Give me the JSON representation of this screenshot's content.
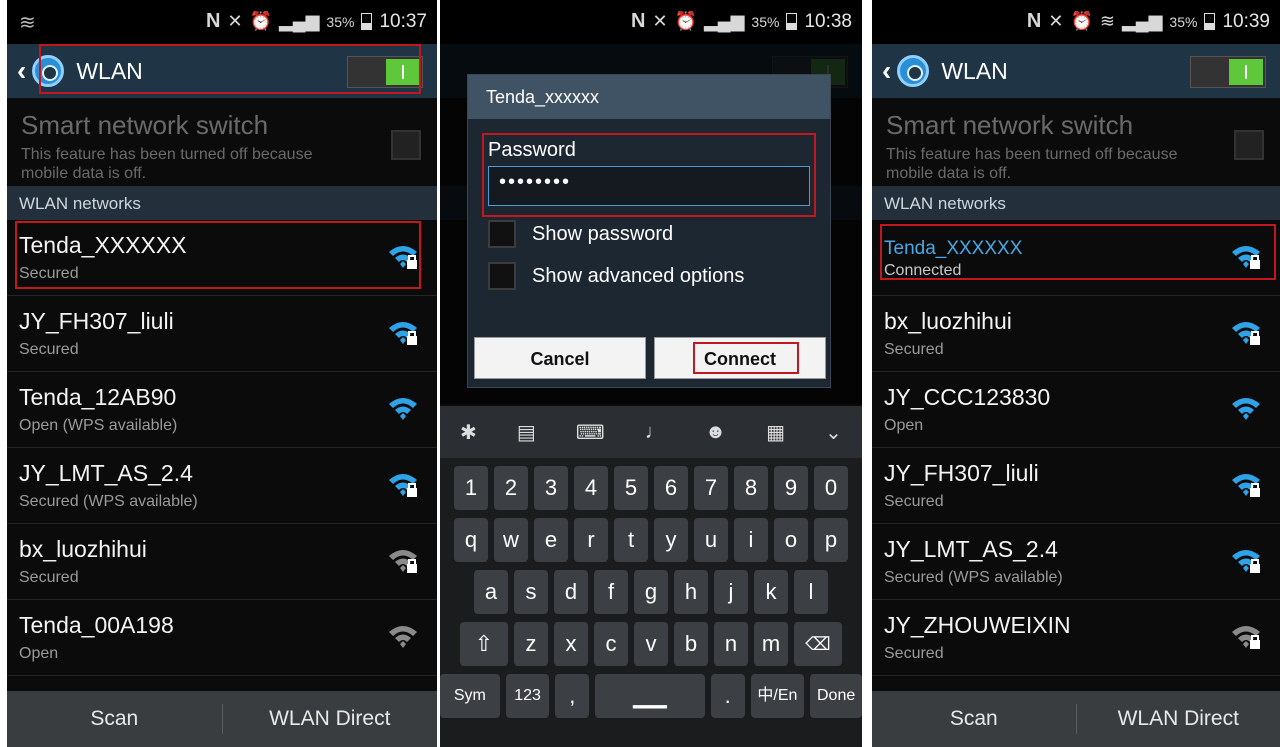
{
  "phone1": {
    "status": {
      "nfc": "N",
      "battery": "35%",
      "time": "10:37"
    },
    "title": "WLAN",
    "smart": {
      "title": "Smart network switch",
      "desc": "This feature has been turned off because mobile data is off."
    },
    "section": "WLAN networks",
    "networks": [
      {
        "name": "Tenda_XXXXXX",
        "status": "Secured",
        "icon": "wifi-lock-icon"
      },
      {
        "name": "JY_FH307_liuli",
        "status": "Secured",
        "icon": "wifi-lock-icon"
      },
      {
        "name": "Tenda_12AB90",
        "status": "Open (WPS available)",
        "icon": "wifi-icon"
      },
      {
        "name": "JY_LMT_AS_2.4",
        "status": "Secured (WPS available)",
        "icon": "wifi-lock-icon"
      },
      {
        "name": "bx_luozhihui",
        "status": "Secured",
        "icon": "wifi-lock-icon"
      },
      {
        "name": "Tenda_00A198",
        "status": "Open",
        "icon": "wifi-icon"
      }
    ],
    "bottom": {
      "scan": "Scan",
      "direct": "WLAN Direct"
    }
  },
  "phone2": {
    "status": {
      "nfc": "N",
      "battery": "35%",
      "time": "10:38"
    },
    "dialog": {
      "title": "Tenda_xxxxxx",
      "password_label": "Password",
      "password_value": "••••••••",
      "show_password": "Show password",
      "show_advanced": "Show advanced options",
      "cancel": "Cancel",
      "connect": "Connect"
    },
    "keyboard": {
      "numbers": [
        "1",
        "2",
        "3",
        "4",
        "5",
        "6",
        "7",
        "8",
        "9",
        "0"
      ],
      "row1": [
        "q",
        "w",
        "e",
        "r",
        "t",
        "y",
        "u",
        "i",
        "o",
        "p"
      ],
      "row2": [
        "a",
        "s",
        "d",
        "f",
        "g",
        "h",
        "j",
        "k",
        "l"
      ],
      "row3": [
        "z",
        "x",
        "c",
        "v",
        "b",
        "n",
        "m"
      ],
      "sym": "Sym",
      "num": "123",
      "comma": ",",
      "period": ".",
      "lang": "中/En",
      "done": "Done"
    }
  },
  "phone3": {
    "status": {
      "nfc": "N",
      "battery": "35%",
      "time": "10:39"
    },
    "title": "WLAN",
    "smart": {
      "title": "Smart network switch",
      "desc": "This feature has been turned off because mobile data is off."
    },
    "section": "WLAN networks",
    "networks": [
      {
        "name": "Tenda_XXXXXX",
        "status": "Connected",
        "icon": "wifi-lock-icon"
      },
      {
        "name": "bx_luozhihui",
        "status": "Secured",
        "icon": "wifi-lock-icon"
      },
      {
        "name": "JY_CCC123830",
        "status": "Open",
        "icon": "wifi-icon"
      },
      {
        "name": "JY_FH307_liuli",
        "status": "Secured",
        "icon": "wifi-lock-icon"
      },
      {
        "name": "JY_LMT_AS_2.4",
        "status": "Secured (WPS available)",
        "icon": "wifi-lock-icon"
      },
      {
        "name": "JY_ZHOUWEIXIN",
        "status": "Secured",
        "icon": "wifi-lock-icon"
      }
    ],
    "bottom": {
      "scan": "Scan",
      "direct": "WLAN Direct"
    }
  },
  "colors": {
    "accent": "#49a8e6",
    "wifi_blue": "#2ea3e8",
    "highlight": "#c0181e",
    "toggle_on": "#5fc83a"
  }
}
